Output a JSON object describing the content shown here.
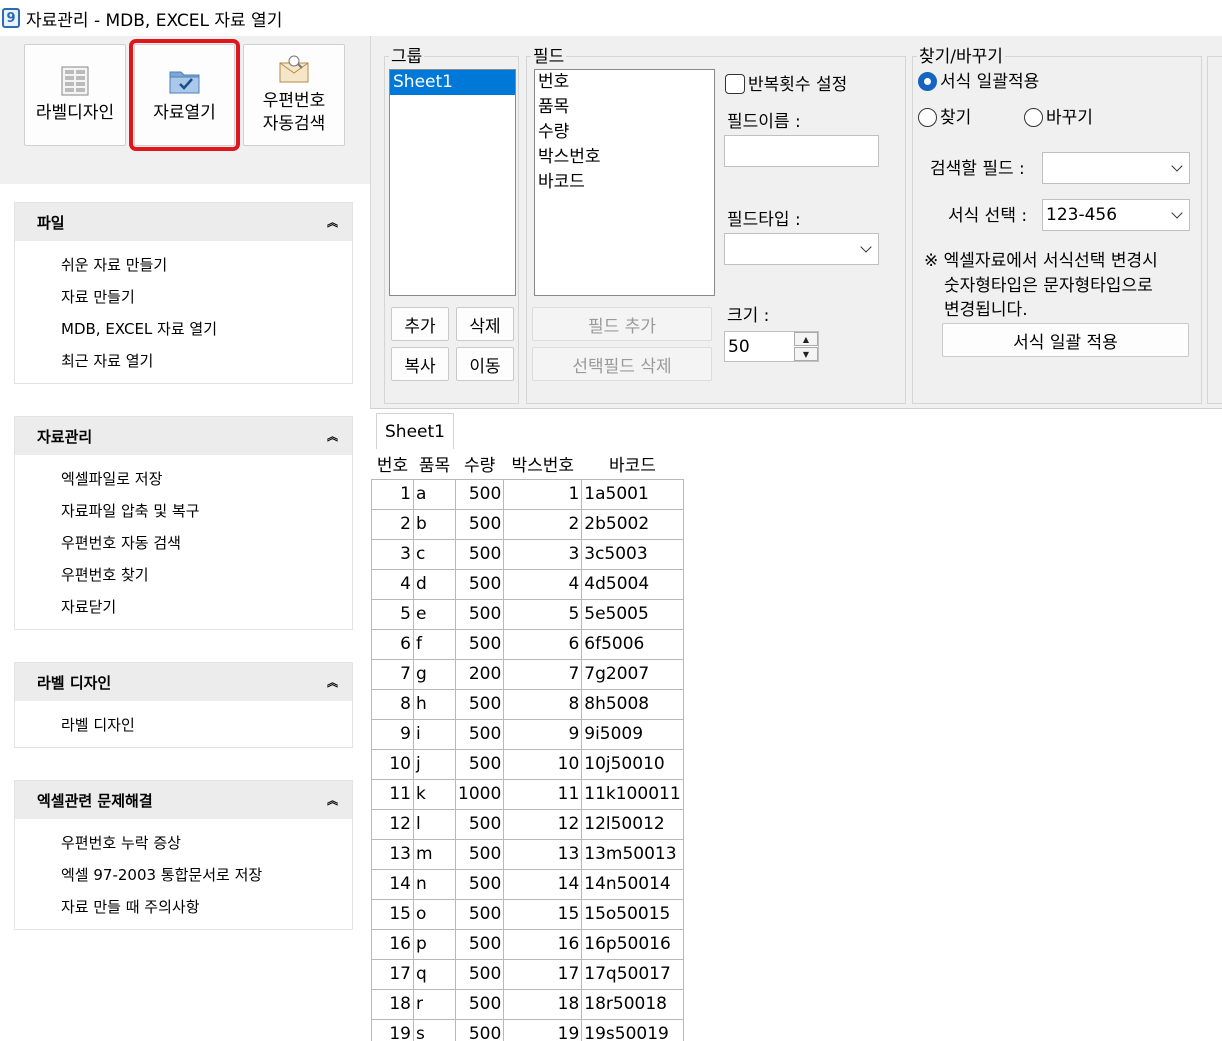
{
  "window": {
    "title": "자료관리 - MDB, EXCEL 자료 열기",
    "icon_text": "9"
  },
  "toolbar": {
    "label_design": "라벨디자인",
    "open_data": "자료열기",
    "zip_line1": "우편번호",
    "zip_line2": "자동검색"
  },
  "panels": [
    {
      "title": "파일",
      "items": [
        "쉬운 자료 만들기",
        "자료 만들기",
        "MDB, EXCEL 자료 열기",
        "최근 자료 열기"
      ]
    },
    {
      "title": "자료관리",
      "items": [
        "엑셀파일로 저장",
        "자료파일 압축 및 복구",
        "우편번호 자동 검색",
        "우편번호 찾기",
        "자료닫기"
      ]
    },
    {
      "title": "라벨 디자인",
      "items": [
        "라벨 디자인"
      ]
    },
    {
      "title": "엑셀관련 문제해결",
      "items": [
        "우편번호 누락 증상",
        "엑셀 97-2003 통합문서로 저장",
        "자료 만들 때 주의사항"
      ]
    }
  ],
  "group": {
    "label": "그룹",
    "items": [
      "Sheet1"
    ],
    "add": "추가",
    "delete": "삭제",
    "copy": "복사",
    "move": "이동"
  },
  "field": {
    "label": "필드",
    "items": [
      "번호",
      "품목",
      "수량",
      "박스번호",
      "바코드"
    ],
    "repeat_label": "반복횟수 설정",
    "name_label": "필드이름 :",
    "type_label": "필드타입 :",
    "size_label": "크기 :",
    "size_value": "50",
    "add_field": "필드 추가",
    "delete_selected": "선택필드 삭제"
  },
  "find": {
    "label": "찾기/바꾸기",
    "apply_format": "서식 일괄적용",
    "find": "찾기",
    "replace": "바꾸기",
    "search_field_label": "검색할 필드 :",
    "search_field_value": "",
    "format_label": "서식 선택 :",
    "format_value": "123-456",
    "note": "※ 엑셀자료에서 서식선택 변경시 숫자형타입은 문자형타입으로 변경됩니다.",
    "note_line1": "※ 엑셀자료에서 서식선택 변경시",
    "note_line2": "숫자형타입은 문자형타입으로",
    "note_line3": "변경됩니다.",
    "apply_button": "서식 일괄 적용"
  },
  "grid": {
    "tab": "Sheet1",
    "columns": [
      "번호",
      "품목",
      "수량",
      "박스번호",
      "바코드"
    ],
    "rows": [
      [
        "1",
        "a",
        "500",
        "1",
        "1a5001"
      ],
      [
        "2",
        "b",
        "500",
        "2",
        "2b5002"
      ],
      [
        "3",
        "c",
        "500",
        "3",
        "3c5003"
      ],
      [
        "4",
        "d",
        "500",
        "4",
        "4d5004"
      ],
      [
        "5",
        "e",
        "500",
        "5",
        "5e5005"
      ],
      [
        "6",
        "f",
        "500",
        "6",
        "6f5006"
      ],
      [
        "7",
        "g",
        "200",
        "7",
        "7g2007"
      ],
      [
        "8",
        "h",
        "500",
        "8",
        "8h5008"
      ],
      [
        "9",
        "i",
        "500",
        "9",
        "9i5009"
      ],
      [
        "10",
        "j",
        "500",
        "10",
        "10j50010"
      ],
      [
        "11",
        "k",
        "1000",
        "11",
        "11k100011"
      ],
      [
        "12",
        "l",
        "500",
        "12",
        "12l50012"
      ],
      [
        "13",
        "m",
        "500",
        "13",
        "13m50013"
      ],
      [
        "14",
        "n",
        "500",
        "14",
        "14n50014"
      ],
      [
        "15",
        "o",
        "500",
        "15",
        "15o50015"
      ],
      [
        "16",
        "p",
        "500",
        "16",
        "16p50016"
      ],
      [
        "17",
        "q",
        "500",
        "17",
        "17q50017"
      ],
      [
        "18",
        "r",
        "500",
        "18",
        "18r50018"
      ],
      [
        "19",
        "s",
        "500",
        "19",
        "19s50019"
      ]
    ]
  },
  "colors": {
    "accent": "#0078d7",
    "highlight": "#e0161d",
    "radio": "#1565c0"
  }
}
